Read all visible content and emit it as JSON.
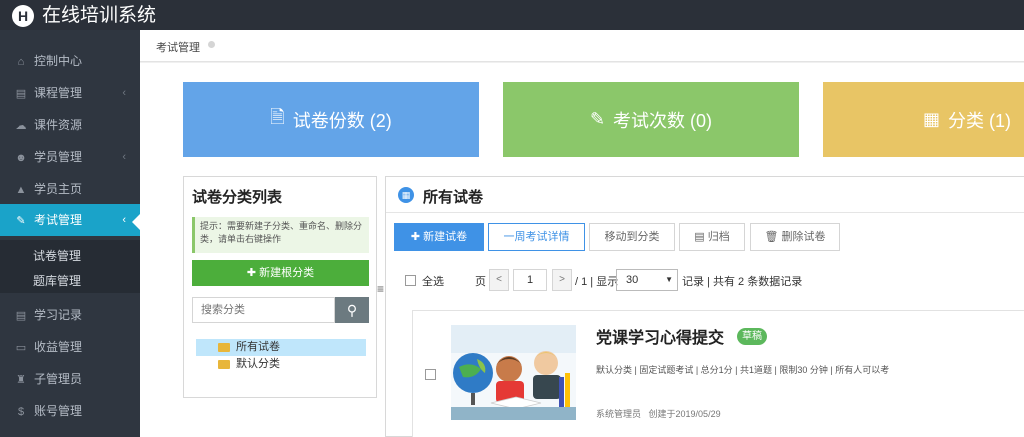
{
  "header": {
    "logo_letter": "H",
    "title": "在线培训系统"
  },
  "sidebar": {
    "items": [
      {
        "label": "控制中心",
        "icon": "home-icon",
        "glyph": "⌂",
        "has_chevron": false
      },
      {
        "label": "课程管理",
        "icon": "book-icon",
        "glyph": "▤",
        "has_chevron": true
      },
      {
        "label": "课件资源",
        "icon": "cloud-icon",
        "glyph": "☁",
        "has_chevron": false
      },
      {
        "label": "学员管理",
        "icon": "users-icon",
        "glyph": "☻",
        "has_chevron": true
      },
      {
        "label": "学员主页",
        "icon": "graduation-cap-icon",
        "glyph": "▲",
        "has_chevron": false
      },
      {
        "label": "考试管理",
        "icon": "edit-icon",
        "glyph": "✎",
        "has_chevron": true,
        "active": true
      },
      {
        "label": "学习记录",
        "icon": "book-icon",
        "glyph": "▤",
        "has_chevron": false
      },
      {
        "label": "收益管理",
        "icon": "card-icon",
        "glyph": "▭",
        "has_chevron": false
      },
      {
        "label": "子管理员",
        "icon": "user-lock-icon",
        "glyph": "♜",
        "has_chevron": false
      },
      {
        "label": "账号管理",
        "icon": "dollar-icon",
        "glyph": "$",
        "has_chevron": false
      }
    ],
    "chevron_glyph": "‹",
    "subitems": [
      "试卷管理",
      "题库管理"
    ]
  },
  "tabs": {
    "current": "考试管理"
  },
  "stats": {
    "papers": {
      "label": "试卷份数 (2)",
      "icon": "file-icon",
      "glyph": "🗎"
    },
    "exams": {
      "label": "考试次数 (0)",
      "icon": "edit-square-icon",
      "glyph": "✎"
    },
    "categories": {
      "label": "分类 (1)",
      "icon": "grid-icon",
      "glyph": "▦"
    }
  },
  "category_panel": {
    "title": "试卷分类列表",
    "hint": "提示：需要新建子分类、重命名、删除分类，请单击右键操作",
    "new_root_label": "新建根分类",
    "search_placeholder": "搜索分类",
    "tree": [
      "所有试卷",
      "默认分类"
    ]
  },
  "paper_panel": {
    "title": "所有试卷",
    "buttons": {
      "new_paper": "新建试卷",
      "week_details": "一周考试详情",
      "move_to_category": "移动到分类",
      "archive": "归档",
      "delete_paper": "删除试卷"
    },
    "select_all": "全选",
    "pager": {
      "page_label": "页",
      "current_page": "1",
      "total_text": "/ 1 | 显示",
      "page_size": "30",
      "records_text": "记录 | 共有 2 条数据记录"
    },
    "papers": [
      {
        "title": "党课学习心得提交",
        "tag": "草稿",
        "meta": "默认分类 | 固定试题考试 | 总分1分 | 共1道题 | 限制30 分钟 | 所有人可以考",
        "author": "系统管理员",
        "created": "创建于2019/05/29"
      }
    ]
  },
  "colors": {
    "accent": "#1aa3c9",
    "primary": "#3f92e6",
    "green": "#4cae3b",
    "stat_blue": "#63a4e8",
    "stat_green": "#8bc76a",
    "stat_yellow": "#e8c565"
  }
}
